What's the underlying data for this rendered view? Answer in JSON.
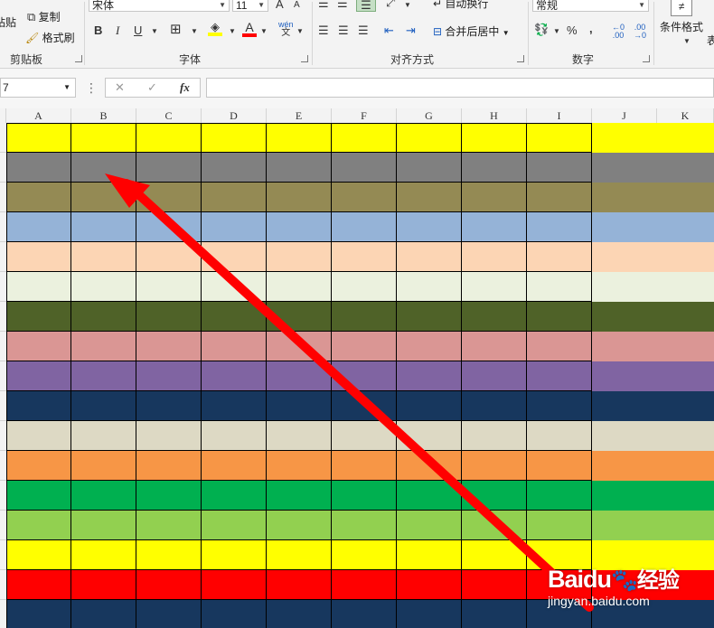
{
  "ribbon": {
    "clipboard": {
      "paste_label": "粘贴",
      "copy_label": "复制",
      "format_painter_label": "格式刷",
      "group_label": "剪贴板"
    },
    "font": {
      "font_name": "宋体",
      "font_size": "11",
      "increase_size": "A",
      "decrease_size": "A",
      "bold": "B",
      "italic": "I",
      "underline": "U",
      "phonetic": "wén",
      "phonetic_char": "文",
      "font_color_letter": "A",
      "group_label": "字体"
    },
    "alignment": {
      "wrap_text_label": "自动换行",
      "merge_center_label": "合并后居中",
      "group_label": "对齐方式"
    },
    "number": {
      "format_value": "常规",
      "percent": "%",
      "comma": ",",
      "group_label": "数字"
    },
    "styles": {
      "conditional_format_label": "条件格式",
      "table_label_partial": "表"
    }
  },
  "formula_bar": {
    "name_box_value": "7",
    "cancel_symbol": "✕",
    "enter_symbol": "✓",
    "fx_label": "fx",
    "formula_value": ""
  },
  "sheet": {
    "columns": [
      "A",
      "B",
      "C",
      "D",
      "E",
      "F",
      "G",
      "H",
      "I",
      "J",
      "K"
    ],
    "row_colors": [
      "#ffff00",
      "#808080",
      "#948a54",
      "#95b3d7",
      "#fcd5b4",
      "#ebf1de",
      "#4f6228",
      "#da9694",
      "#8064a2",
      "#17375e",
      "#ddd9c4",
      "#f79646",
      "#00b050",
      "#92d050",
      "#ffff00",
      "#ff0000",
      "#17375e"
    ]
  },
  "annotation": {
    "arrow_color": "#ff0000"
  },
  "watermark": {
    "brand": "Baidu",
    "brand_cn": "经验",
    "url": "jingyan.baidu.com"
  }
}
